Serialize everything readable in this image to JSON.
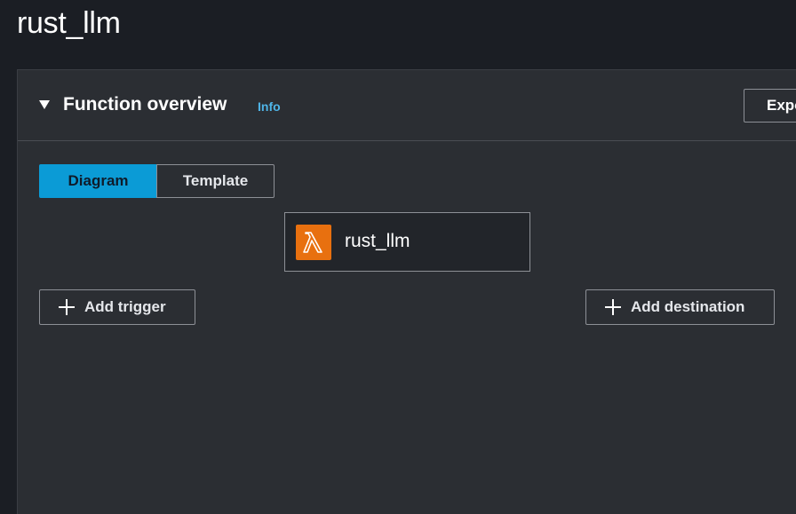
{
  "page": {
    "title": "rust_llm"
  },
  "overview": {
    "title": "Function overview",
    "info_label": "Info",
    "export_label": "Export"
  },
  "view_toggle": {
    "options": [
      "Diagram",
      "Template"
    ],
    "selected": "Diagram"
  },
  "function_card": {
    "name": "rust_llm",
    "icon": "lambda-icon"
  },
  "actions": {
    "add_trigger": "Add trigger",
    "add_destination": "Add destination"
  },
  "colors": {
    "accent": "#0b9bd6",
    "link": "#4fb5e8",
    "lambda_orange": "#e8700f"
  }
}
